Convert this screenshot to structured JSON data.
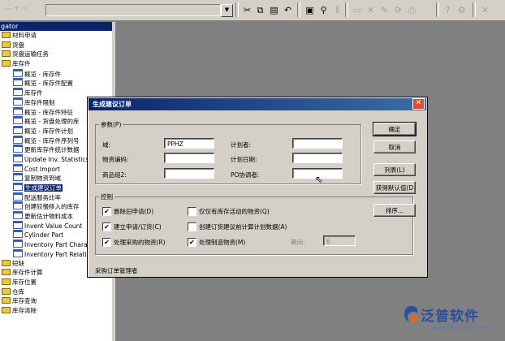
{
  "toolbar": {
    "left_text": "— 十 ⅓",
    "icons": [
      "cut-icon",
      "copy-icon",
      "paste-icon",
      "undo-icon",
      "preview-icon",
      "find-icon"
    ],
    "disabled_icons": [
      "new-icon",
      "save-icon",
      "delete-icon",
      "edit-icon",
      "refresh-icon",
      "print-icon",
      "help-icon"
    ]
  },
  "navigator": {
    "title": "gator",
    "items": [
      {
        "label": "材料申请",
        "type": "folder"
      },
      {
        "label": "货盘",
        "type": "folder"
      },
      {
        "label": "货盘运输任务",
        "type": "folder"
      },
      {
        "label": "库存件",
        "type": "folder"
      },
      {
        "label": "概览 - 库存件",
        "type": "doc"
      },
      {
        "label": "概览 - 库存件配置",
        "type": "doc"
      },
      {
        "label": "库存件",
        "type": "doc"
      },
      {
        "label": "库存件限制",
        "type": "doc"
      },
      {
        "label": "概览 - 库存件特征",
        "type": "doc"
      },
      {
        "label": "概览 - 货盘处理的库",
        "type": "doc"
      },
      {
        "label": "概览 - 库存件计划",
        "type": "doc"
      },
      {
        "label": "概览 - 库存件序列号",
        "type": "doc"
      },
      {
        "label": "更新库存件统计数据",
        "type": "doc"
      },
      {
        "label": "Update Inv. Statistics(I",
        "type": "doc"
      },
      {
        "label": "Cost Import",
        "type": "doc"
      },
      {
        "label": "复制物资到域",
        "type": "doc"
      },
      {
        "label": "生成建议订单",
        "type": "doc",
        "selected": true
      },
      {
        "label": "配送服务比率",
        "type": "doc"
      },
      {
        "label": "创建较慢移入的库存",
        "type": "doc"
      },
      {
        "label": "更新估计物料成本",
        "type": "doc"
      },
      {
        "label": "Invent Value Count",
        "type": "doc"
      },
      {
        "label": "Cylinder Part",
        "type": "doc"
      },
      {
        "label": "Inventory Part Charact",
        "type": "doc"
      },
      {
        "label": "Inventory Part Relation",
        "type": "doc"
      },
      {
        "label": "短缺",
        "type": "folder"
      },
      {
        "label": "库存件计算",
        "type": "folder"
      },
      {
        "label": "库存位置",
        "type": "folder"
      },
      {
        "label": "仓库",
        "type": "folder"
      },
      {
        "label": "库存查询",
        "type": "folder"
      },
      {
        "label": "库存清除",
        "type": "folder"
      }
    ]
  },
  "dialog": {
    "title": "生成建议订单",
    "params_label": "参数(P)",
    "fields": {
      "domain_label": "域:",
      "domain_value": "PPHZ",
      "item_code_label": "物资编码:",
      "item_code_value": "",
      "product_group_label": "商品组2:",
      "product_group_value": "",
      "planner_label": "计划者:",
      "planner_value": "",
      "plan_date_label": "计划日期:",
      "plan_date_value": "",
      "po_coordinator_label": "PO协调者:",
      "po_coordinator_value": ""
    },
    "control_label": "控制",
    "checkboxes": [
      {
        "label": "删除旧申请(D)",
        "checked": true
      },
      {
        "label": "建立申请/订货(C)",
        "checked": true
      },
      {
        "label": "处理采购的物资(R)",
        "checked": true
      },
      {
        "label": "仅仅有库存活动的物资(Q)",
        "checked": false
      },
      {
        "label": "创建订货建议前计算计划数据(A)",
        "checked": false
      },
      {
        "label": "处理制造物资(M)",
        "checked": true
      }
    ],
    "period_label": "期间:",
    "period_value": "6",
    "buttons": {
      "ok": "确定",
      "cancel": "取消",
      "list": "列表(L)",
      "defaults": "获得默认值(D",
      "sort": "排序..."
    },
    "status": "采购订单管理者"
  },
  "brand": {
    "name": "泛普软件",
    "url": "www.fanpusoft.com",
    "color": "#2b4f9e"
  }
}
